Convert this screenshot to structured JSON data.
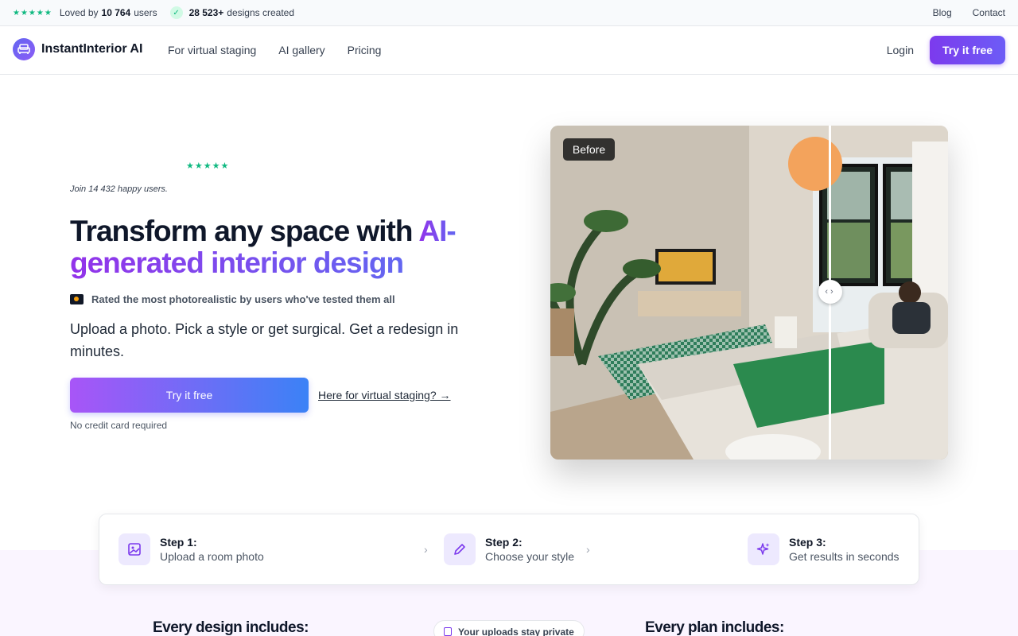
{
  "topbar": {
    "stars": "★★★★★",
    "loved_prefix": "Loved by",
    "loved_count": "10 764",
    "loved_suffix": "users",
    "designs_count": "28 523+",
    "designs_suffix": "designs created",
    "links": [
      "Blog",
      "Contact"
    ]
  },
  "nav": {
    "brand": "InstantInterior AI",
    "links": [
      "For virtual staging",
      "AI gallery",
      "Pricing"
    ],
    "login": "Login",
    "cta": "Try it free"
  },
  "hero": {
    "stars": "★★★★★",
    "join": "Join 14 432 happy users.",
    "title_plain": "Transform any space with ",
    "title_grad_1": "AI-",
    "title_grad_2": "generated interior design",
    "rated": "Rated the most photorealistic by users who've tested them all",
    "subtitle": "Upload a photo. Pick a style or get surgical. Get a redesign in minutes.",
    "cta": "Try it free",
    "staging_link": "Here for virtual staging? →",
    "no_card": "No credit card required",
    "before_label": "Before",
    "slider_glyphs": "‹›"
  },
  "steps": [
    {
      "title": "Step 1:",
      "desc": "Upload a room photo",
      "icon": "image-icon"
    },
    {
      "title": "Step 2:",
      "desc": "Choose your style",
      "icon": "pencil-icon"
    },
    {
      "title": "Step 3:",
      "desc": "Get results in seconds",
      "icon": "sparkles-icon"
    }
  ],
  "bottom": {
    "design_includes": "Every design includes:",
    "privacy": "Your uploads stay private",
    "plan_includes": "Every plan includes:"
  },
  "colors": {
    "accent": "#7c3aed",
    "star_green": "#10b981",
    "gradient_start": "#a855f7",
    "gradient_end": "#3b82f6"
  }
}
